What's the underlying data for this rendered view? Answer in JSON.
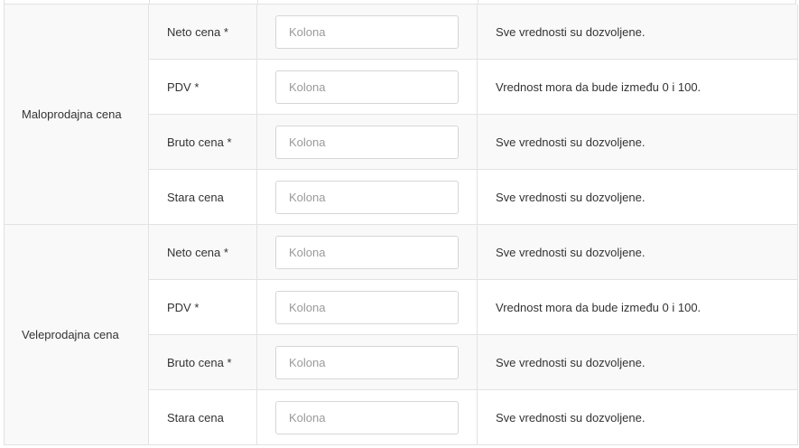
{
  "groups": [
    {
      "label": "Maloprodajna cena",
      "rows": [
        {
          "field": "Neto cena *",
          "placeholder": "Kolona",
          "value": "",
          "description": "Sve vrednosti su dozvoljene."
        },
        {
          "field": "PDV *",
          "placeholder": "Kolona",
          "value": "",
          "description": "Vrednost mora da bude između 0 i 100."
        },
        {
          "field": "Bruto cena *",
          "placeholder": "Kolona",
          "value": "",
          "description": "Sve vrednosti su dozvoljene."
        },
        {
          "field": "Stara cena",
          "placeholder": "Kolona",
          "value": "",
          "description": "Sve vrednosti su dozvoljene."
        }
      ]
    },
    {
      "label": "Veleprodajna cena",
      "rows": [
        {
          "field": "Neto cena *",
          "placeholder": "Kolona",
          "value": "",
          "description": "Sve vrednosti su dozvoljene."
        },
        {
          "field": "PDV *",
          "placeholder": "Kolona",
          "value": "",
          "description": "Vrednost mora da bude između 0 i 100."
        },
        {
          "field": "Bruto cena *",
          "placeholder": "Kolona",
          "value": "",
          "description": "Sve vrednosti su dozvoljene."
        },
        {
          "field": "Stara cena",
          "placeholder": "Kolona",
          "value": "",
          "description": "Sve vrednosti su dozvoljene."
        }
      ]
    }
  ],
  "colors": {
    "border": "#e2e2e2",
    "shaded_row": "#f9f9f9",
    "text": "#333333",
    "placeholder": "#9a9a9a"
  }
}
